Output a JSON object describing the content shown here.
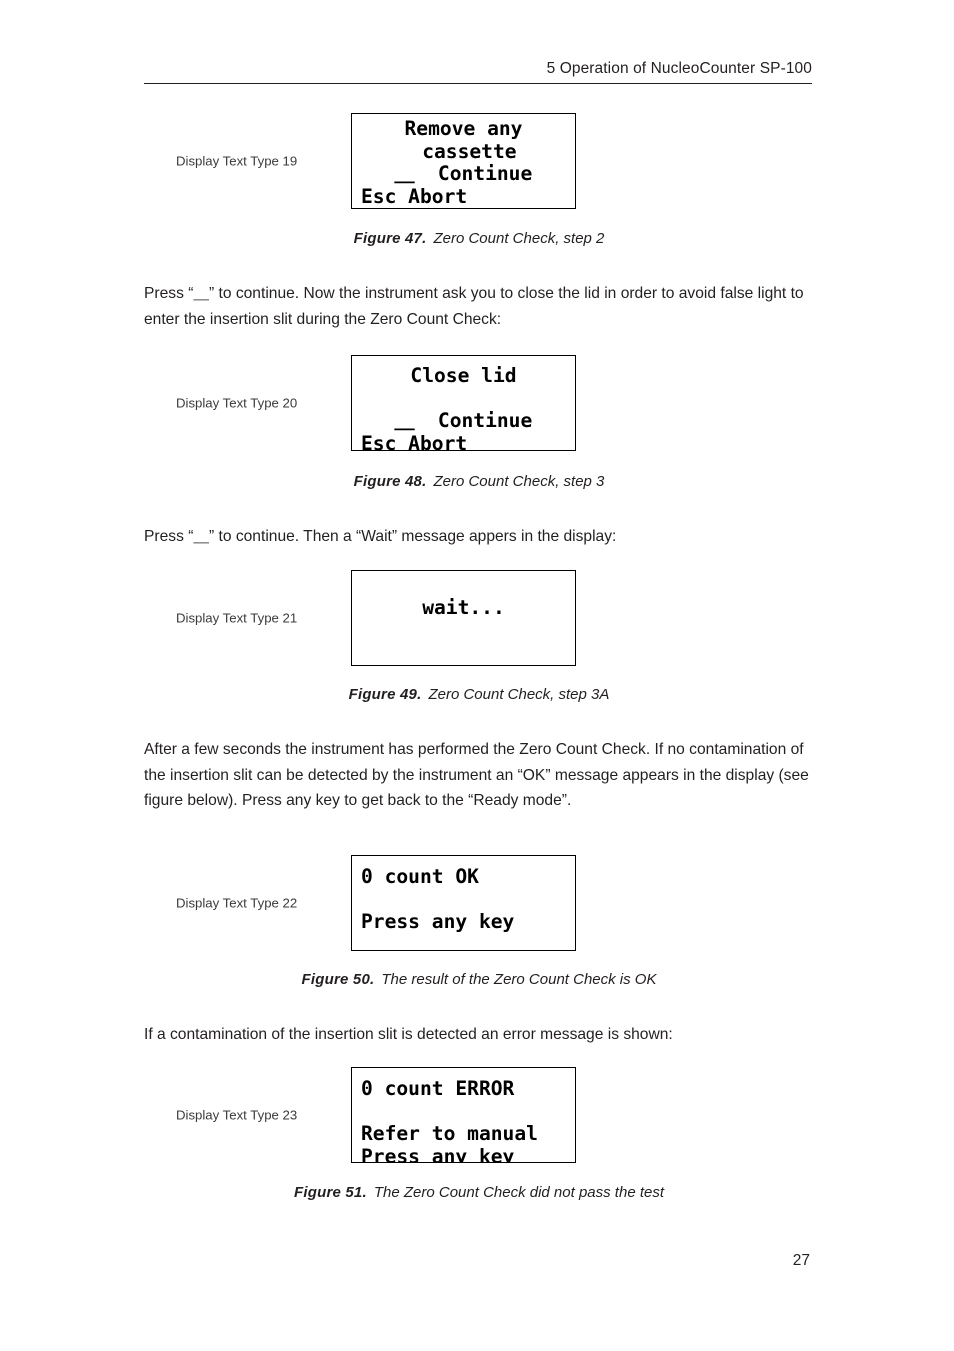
{
  "header": {
    "title": "5 Operation of NucleoCounter SP-100"
  },
  "figures": [
    {
      "label": "Display Text Type 19",
      "lines": [
        "Remove any",
        " cassette",
        "⸏  Continue",
        "Esc Abort"
      ],
      "caption_label": "Figure 47.",
      "caption_text": "Zero Count Check, step 2"
    },
    {
      "label": "Display Text Type 20",
      "lines": [
        "Close lid",
        "",
        "⸏  Continue",
        "Esc Abort"
      ],
      "caption_label": "Figure 48.",
      "caption_text": "Zero Count Check, step 3"
    },
    {
      "label": "Display Text Type 21",
      "lines": [
        "",
        "wait...",
        "",
        ""
      ],
      "caption_label": "Figure 49.",
      "caption_text": "Zero Count Check, step 3A"
    },
    {
      "label": "Display Text Type 22",
      "lines": [
        "0 count OK",
        "",
        "Press any key",
        ""
      ],
      "caption_label": "Figure 50.",
      "caption_text": "The result of the Zero Count Check is OK"
    },
    {
      "label": "Display Text Type 23",
      "lines": [
        "0 count ERROR",
        "",
        "Refer to manual",
        "Press any key"
      ],
      "caption_label": "Figure 51.",
      "caption_text": "The Zero Count Check did not pass the test"
    }
  ],
  "paragraphs": {
    "p1": "Press “⸏” to continue. Now the instrument ask you to close the lid in order to avoid false light to enter the insertion slit during the Zero Count Check:",
    "p2": "Press “⸏” to continue. Then a “Wait” message appers in the display:",
    "p3": "After a few seconds the instrument has performed the Zero Count Check. If no contamination of the insertion slit can be detected by the instrument an “OK” message appears in the display (see figure below). Press any key to get back to the “Ready mode”.",
    "p4": "If a contamination of the insertion slit is detected an error message is shown:"
  },
  "footer": {
    "page_number": "27"
  }
}
